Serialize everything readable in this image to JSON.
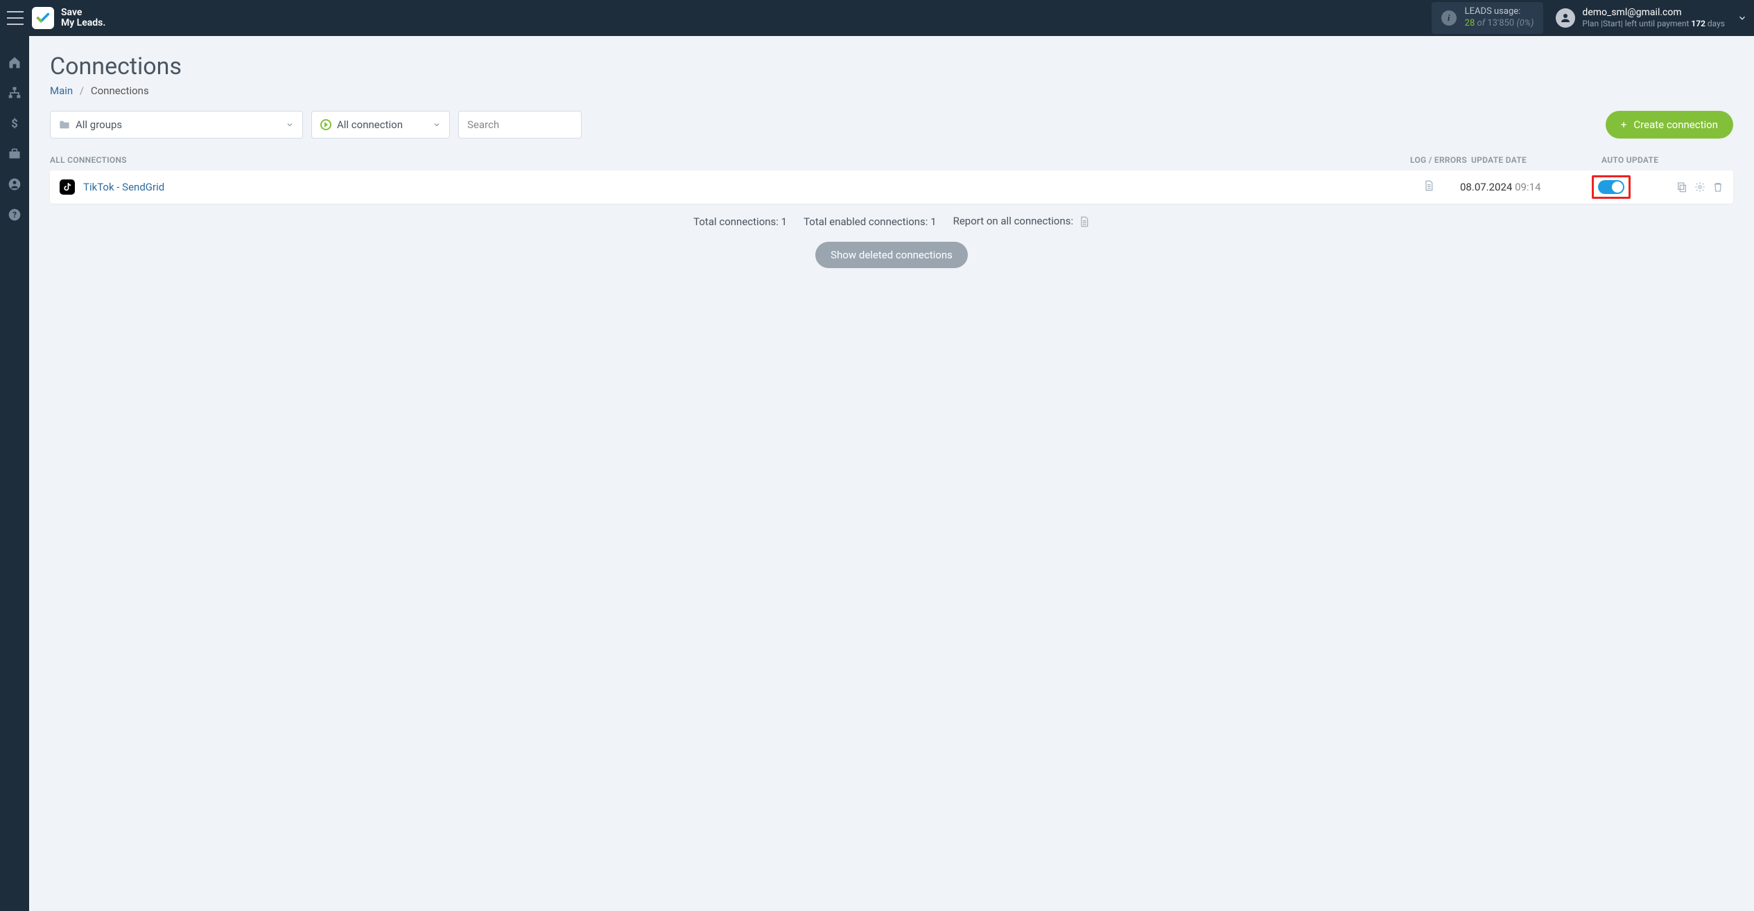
{
  "brand": {
    "line1": "Save",
    "line2": "My Leads."
  },
  "leads_usage": {
    "label": "LEADS usage:",
    "used": "28",
    "of": "of",
    "total": "13'850",
    "pct": "(0%)"
  },
  "user": {
    "email": "demo_sml@gmail.com",
    "plan_prefix": "Plan |Start| left until payment ",
    "days": "172",
    "days_suffix": " days"
  },
  "page": {
    "title": "Connections",
    "breadcrumb_main": "Main",
    "breadcrumb_current": "Connections"
  },
  "filters": {
    "groups_label": "All groups",
    "status_label": "All connection",
    "search_placeholder": "Search"
  },
  "create_btn": "Create connection",
  "table": {
    "header_name": "ALL CONNECTIONS",
    "header_log": "LOG / ERRORS",
    "header_date": "UPDATE DATE",
    "header_auto": "AUTO UPDATE"
  },
  "rows": [
    {
      "name": "TikTok - SendGrid",
      "date": "08.07.2024",
      "time": "09:14"
    }
  ],
  "summary": {
    "total": "Total connections: 1",
    "enabled": "Total enabled connections: 1",
    "report": "Report on all connections:"
  },
  "show_deleted": "Show deleted connections"
}
